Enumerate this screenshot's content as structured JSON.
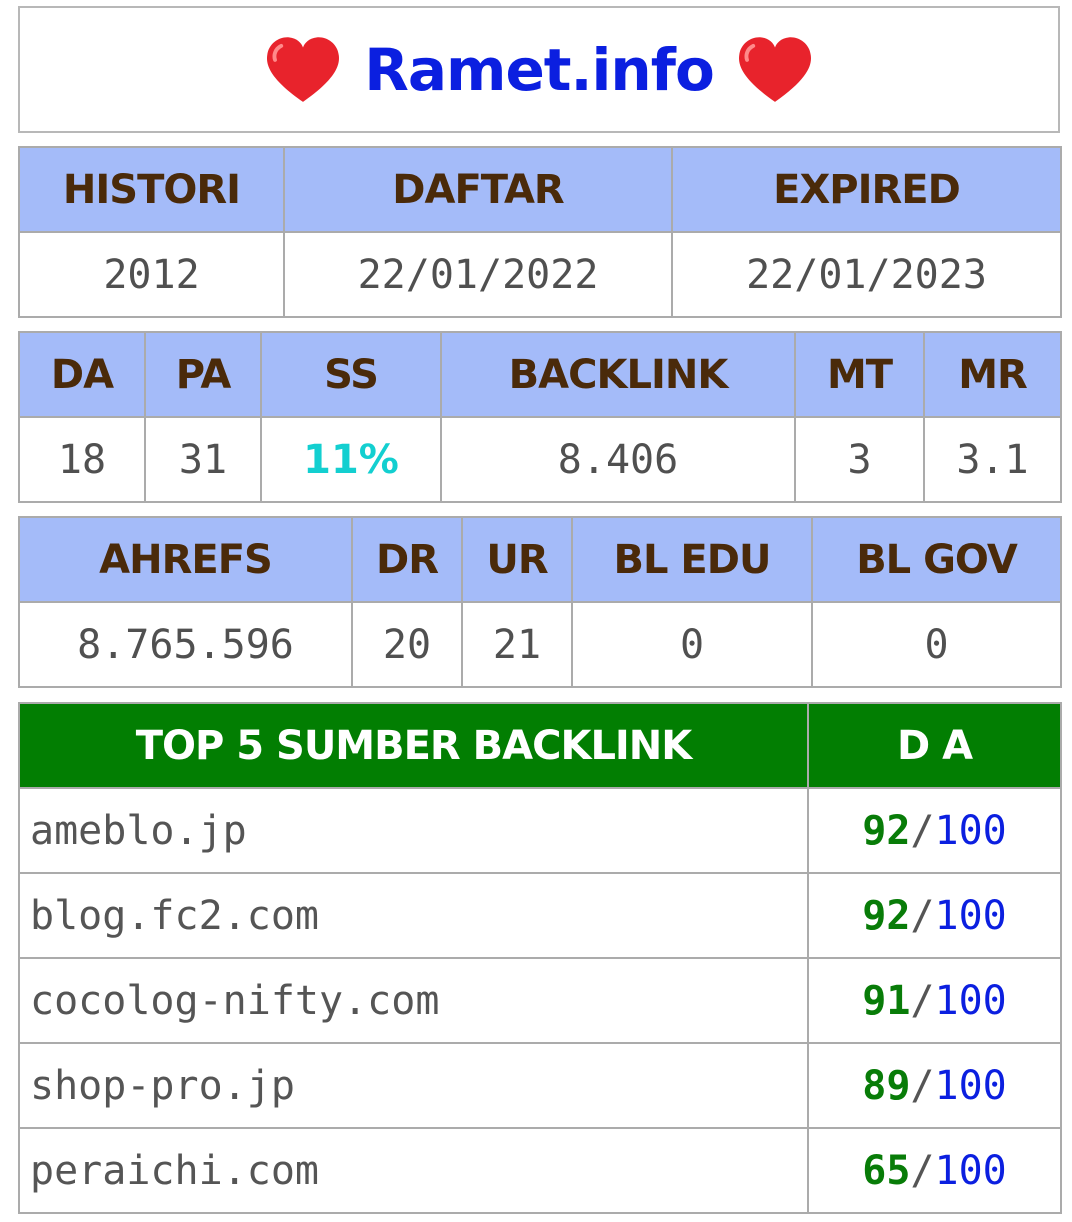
{
  "header": {
    "site_name": "Ramet.info",
    "icon": "heart-icon",
    "icon_color": "#e8232c",
    "title_color": "#0b1fe0"
  },
  "dates": {
    "headers": [
      "HISTORI",
      "DAFTAR",
      "EXPIRED"
    ],
    "values": [
      "2012",
      "22/01/2022",
      "22/01/2023"
    ]
  },
  "moz": {
    "headers": [
      "DA",
      "PA",
      "SS",
      "BACKLINK",
      "MT",
      "MR"
    ],
    "values": [
      "18",
      "31",
      "11%",
      "8.406",
      "3",
      "3.1"
    ]
  },
  "ahrefs": {
    "headers": [
      "AHREFS",
      "DR",
      "UR",
      "BL EDU",
      "BL GOV"
    ],
    "values": [
      "8.765.596",
      "20",
      "21",
      "0",
      "0"
    ]
  },
  "top_backlinks": {
    "header_source": "TOP 5 SUMBER BACKLINK",
    "header_da": "D A",
    "separator": "/",
    "rows": [
      {
        "domain": "ameblo.jp",
        "score": "92",
        "max": "100"
      },
      {
        "domain": "blog.fc2.com",
        "score": "92",
        "max": "100"
      },
      {
        "domain": "cocolog-nifty.com",
        "score": "91",
        "max": "100"
      },
      {
        "domain": "shop-pro.jp",
        "score": "89",
        "max": "100"
      },
      {
        "domain": "peraichi.com",
        "score": "65",
        "max": "100"
      }
    ]
  },
  "colors": {
    "header_blue": "#a4bbf9",
    "header_green": "#027e02",
    "score_green": "#087c08",
    "ss_cyan": "#13cfd0"
  }
}
